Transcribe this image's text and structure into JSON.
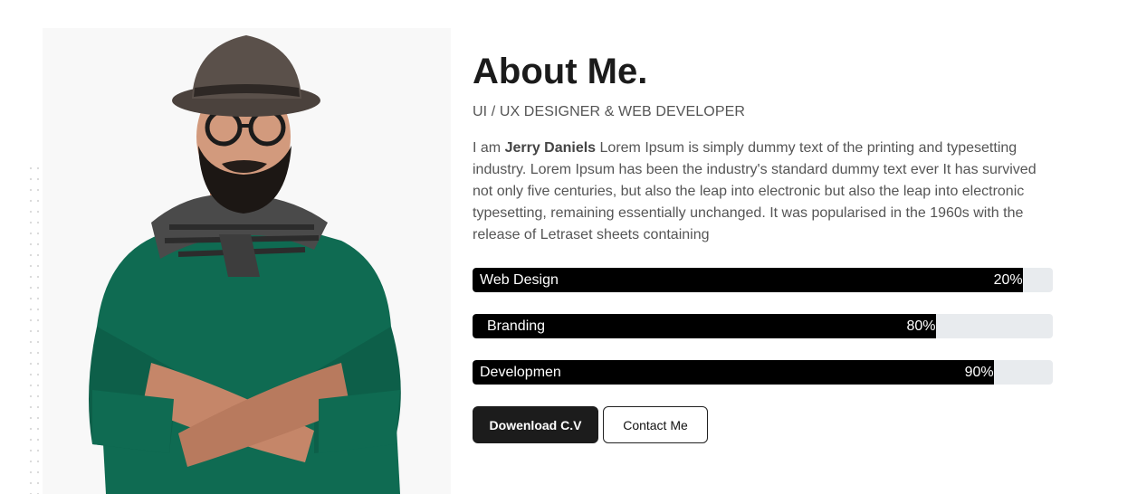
{
  "about": {
    "title": "About Me.",
    "subtitle": "UI / UX DESIGNER & WEB DEVELOPER",
    "bio_prefix": "I am ",
    "bio_name": "Jerry Daniels",
    "bio_text": " Lorem Ipsum is simply dummy text of the printing and typesetting industry. Lorem Ipsum has been the industry's standard dummy text ever It has survived not only five centuries, but also the leap into electronic but also the leap into electronic typesetting, remaining essentially unchanged. It was popularised in the 1960s with the release of Letraset sheets containing"
  },
  "skills": [
    {
      "label": "Web Design",
      "percent_label": "20%",
      "fill_fraction": 0.948
    },
    {
      "label": "Branding",
      "percent_label": "80%",
      "fill_fraction": 0.798
    },
    {
      "label": "Developmen",
      "percent_label": "90%",
      "fill_fraction": 0.898
    }
  ],
  "buttons": {
    "download_cv": "Dowenload C.V",
    "contact_me": "Contact Me"
  },
  "colors": {
    "accent": "#000000",
    "track": "#e8ebee",
    "sweater": "#0f6b52"
  }
}
